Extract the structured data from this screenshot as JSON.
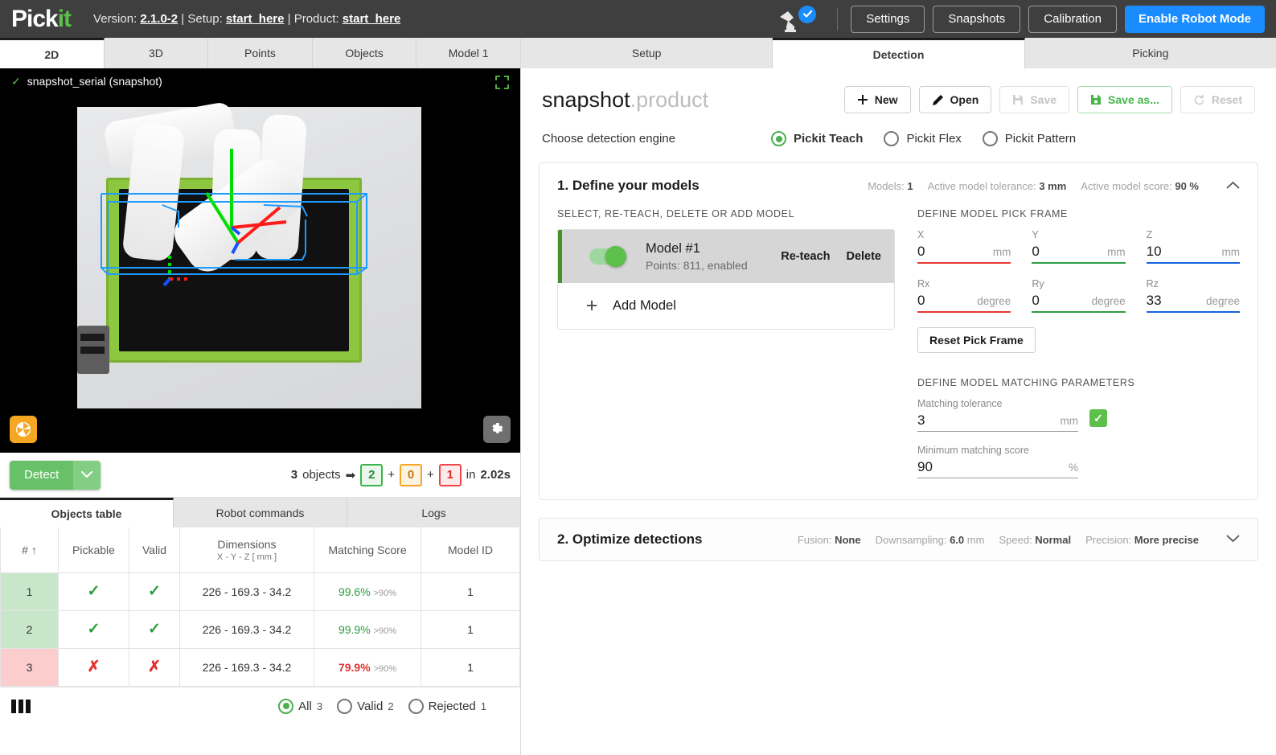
{
  "topbar": {
    "logo_text": "Pick",
    "logo_accent": "it",
    "version_label": "Version:",
    "version_value": "2.1.0-2",
    "sep1": "|",
    "setup_label": "Setup:",
    "setup_value": "start_here",
    "sep2": "|",
    "product_label": "Product:",
    "product_value": "start_here",
    "robot_icon": "robot-arm-icon",
    "status_icon": "check-circle-icon",
    "buttons": [
      {
        "label": "Settings",
        "name": "settings-button"
      },
      {
        "label": "Snapshots",
        "name": "snapshots-button"
      },
      {
        "label": "Calibration",
        "name": "calibration-button"
      }
    ],
    "primary_button": "Enable Robot Mode",
    "accent_color": "#1a8cff"
  },
  "left": {
    "tabs": [
      {
        "label": "2D",
        "active": true
      },
      {
        "label": "3D",
        "active": false
      },
      {
        "label": "Points",
        "active": false
      },
      {
        "label": "Objects",
        "active": false
      },
      {
        "label": "Model 1",
        "active": false
      }
    ],
    "camera": {
      "status_check": "✓",
      "source_title": "snapshot_serial (snapshot)",
      "fullscreen_icon": "fullscreen-icon",
      "capture_icon": "aperture-icon",
      "settings_icon": "gear-icon"
    },
    "detect": {
      "button_label": "Detect",
      "caret_icon": "chevron-down-icon",
      "count_total": "3",
      "objects_word": "objects",
      "arrow": "➡",
      "valid_count": "2",
      "plus1": "+",
      "warn_count": "0",
      "plus2": "+",
      "rejected_count": "1",
      "time_prefix": "in",
      "time_value": "2.02s"
    },
    "bottom_tabs": [
      {
        "label": "Objects table",
        "active": true
      },
      {
        "label": "Robot commands",
        "active": false
      },
      {
        "label": "Logs",
        "active": false
      }
    ],
    "table": {
      "headers": [
        "#",
        "Pickable",
        "Valid",
        "Dimensions",
        "Matching Score",
        "Model ID"
      ],
      "dimensions_sub": "X - Y - Z [ mm ]",
      "sort_icon": "arrow-up-icon",
      "rows": [
        {
          "index": "1",
          "pickable": "✓",
          "valid": "✓",
          "ok": true,
          "dimensions": "226 - 169.3 - 34.2",
          "score": "99.6%",
          "score_sub": ">90%",
          "score_ok": true,
          "model_id": "1"
        },
        {
          "index": "2",
          "pickable": "✓",
          "valid": "✓",
          "ok": true,
          "dimensions": "226 - 169.3 - 34.2",
          "score": "99.9%",
          "score_sub": ">90%",
          "score_ok": true,
          "model_id": "1"
        },
        {
          "index": "3",
          "pickable": "✗",
          "valid": "✗",
          "ok": false,
          "dimensions": "226 - 169.3 - 34.2",
          "score": "79.9%",
          "score_sub": ">90%",
          "score_ok": false,
          "model_id": "1"
        }
      ],
      "footer": {
        "columns_icon": "columns-icon",
        "filters": [
          {
            "label": "All",
            "count": "3",
            "selected": true
          },
          {
            "label": "Valid",
            "count": "2",
            "selected": false
          },
          {
            "label": "Rejected",
            "count": "1",
            "selected": false
          }
        ]
      }
    }
  },
  "right": {
    "tabs": [
      {
        "label": "Setup",
        "active": false
      },
      {
        "label": "Detection",
        "active": true
      },
      {
        "label": "Picking",
        "active": false
      }
    ],
    "product": {
      "name": "snapshot",
      "extension": ".product",
      "actions": [
        {
          "label": "New",
          "icon": "plus-icon",
          "state": "normal",
          "name": "new-button"
        },
        {
          "label": "Open",
          "icon": "pencil-icon",
          "state": "normal",
          "name": "open-button"
        },
        {
          "label": "Save",
          "icon": "save-icon",
          "state": "disabled",
          "name": "save-button"
        },
        {
          "label": "Save as...",
          "icon": "save-icon",
          "state": "green",
          "name": "save-as-button"
        },
        {
          "label": "Reset",
          "icon": "refresh-icon",
          "state": "disabled",
          "name": "reset-button"
        }
      ]
    },
    "engine": {
      "label": "Choose detection engine",
      "options": [
        {
          "label": "Pickit Teach",
          "selected": true
        },
        {
          "label": "Pickit Flex",
          "selected": false
        },
        {
          "label": "Pickit Pattern",
          "selected": false
        }
      ]
    },
    "section1": {
      "title": "1. Define your models",
      "meta": [
        {
          "key": "Models:",
          "value": "1"
        },
        {
          "key": "Active model tolerance:",
          "value": "3 mm"
        },
        {
          "key": "Active model score:",
          "value": "90 %"
        }
      ],
      "collapse_icon": "chevron-up-icon",
      "models_caption": "SELECT, RE-TEACH, DELETE OR ADD MODEL",
      "model": {
        "name": "Model #1",
        "subtitle": "Points: 811, enabled",
        "reteach_label": "Re-teach",
        "delete_label": "Delete",
        "enabled": true
      },
      "add_model_label": "Add Model",
      "pick_frame_caption": "DEFINE MODEL PICK FRAME",
      "pick_frame": [
        {
          "label": "X",
          "value": "0",
          "unit": "mm",
          "color": "red"
        },
        {
          "label": "Y",
          "value": "0",
          "unit": "mm",
          "color": "green"
        },
        {
          "label": "Z",
          "value": "10",
          "unit": "mm",
          "color": "blue"
        },
        {
          "label": "Rx",
          "value": "0",
          "unit": "degree",
          "color": "red"
        },
        {
          "label": "Ry",
          "value": "0",
          "unit": "degree",
          "color": "green"
        },
        {
          "label": "Rz",
          "value": "33",
          "unit": "degree",
          "color": "blue"
        }
      ],
      "reset_pick_frame_label": "Reset Pick Frame",
      "matching_caption": "DEFINE MODEL MATCHING PARAMETERS",
      "matching_tolerance_label": "Matching tolerance",
      "matching_tolerance_value": "3",
      "matching_tolerance_unit": "mm",
      "matching_ok_icon": "check-icon",
      "min_score_label": "Minimum matching score",
      "min_score_value": "90",
      "min_score_unit": "%"
    },
    "section2": {
      "title": "2. Optimize detections",
      "meta": [
        {
          "key": "Fusion:",
          "value": "None"
        },
        {
          "key": "Downsampling:",
          "value": "6.0",
          "suffix": "mm"
        },
        {
          "key": "Speed:",
          "value": "Normal"
        },
        {
          "key": "Precision:",
          "value": "More precise"
        }
      ],
      "expand_icon": "chevron-down-icon"
    }
  }
}
